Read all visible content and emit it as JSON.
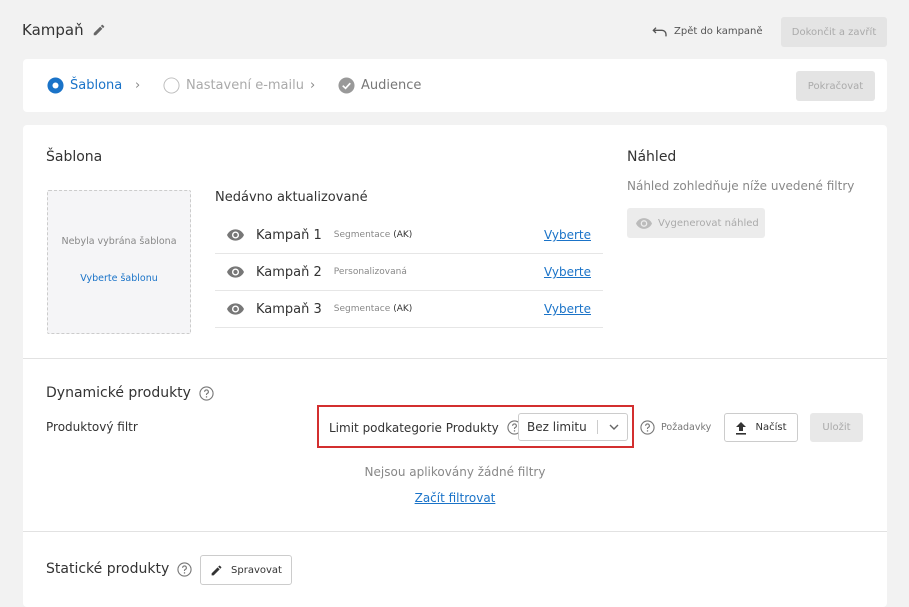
{
  "header": {
    "title": "Kampaň",
    "back_label": "Zpět do kampaně",
    "finish_label": "Dokončit a zavřít"
  },
  "stepper": {
    "steps": [
      {
        "label": "Šablona",
        "state": "active"
      },
      {
        "label": "Nastavení e-mailu",
        "state": "inactive"
      },
      {
        "label": "Audience",
        "state": "done"
      }
    ],
    "continue_label": "Pokračovat"
  },
  "template_section": {
    "title": "Šablona",
    "placeholder_text": "Nebyla vybrána šablona",
    "placeholder_link": "Vyberte šablonu",
    "recent_title": "Nedávno aktualizované",
    "recent": [
      {
        "name": "Kampaň 1",
        "type": "Segmentace",
        "tag": "(AK)",
        "action": "Vyberte"
      },
      {
        "name": "Kampaň 2",
        "type": "Personalizovaná",
        "tag": "",
        "action": "Vyberte"
      },
      {
        "name": "Kampaň 3",
        "type": "Segmentace",
        "tag": "(AK)",
        "action": "Vyberte"
      }
    ]
  },
  "preview": {
    "title": "Náhled",
    "description": "Náhled zohledňuje níže uvedené filtry",
    "generate_label": "Vygenerovat náhled"
  },
  "dynamic_products": {
    "title": "Dynamické produkty",
    "filter_label": "Produktový filtr",
    "limit_label": "Limit podkategorie Produkty",
    "limit_value": "Bez limitu",
    "requirements_label": "Požadavky",
    "load_label": "Načíst",
    "save_label": "Uložit",
    "no_filters": "Nejsou aplikovány žádné filtry",
    "start_filter": "Začít filtrovat"
  },
  "static_products": {
    "title": "Statické produkty",
    "manage_label": "Spravovat"
  },
  "colors": {
    "accent": "#1a73c8",
    "highlight_border": "#d32f2f"
  }
}
